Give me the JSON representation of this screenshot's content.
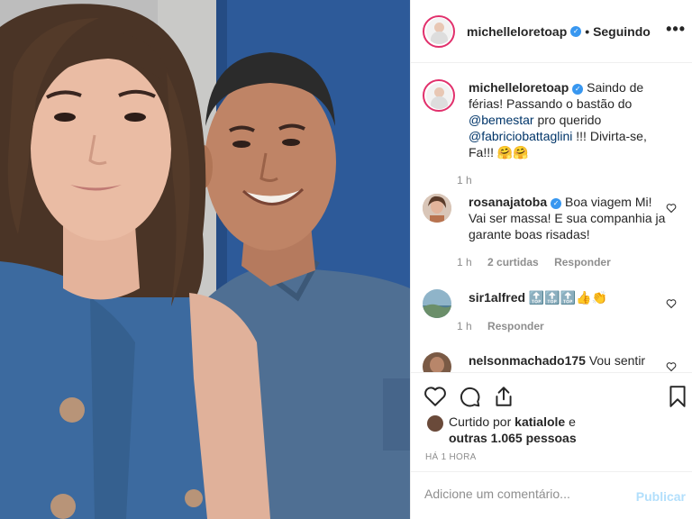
{
  "post": {
    "author": "michelleloretoap",
    "follow_status": "Seguindo",
    "more_label": "•••"
  },
  "caption": {
    "user": "michelleloretoap",
    "text_1": " Saindo de férias! Passando o bastão do ",
    "mention_1": "@bemestar",
    "text_2": " pro querido ",
    "mention_2": "@fabriciobattaglini",
    "text_3": " !!! Divirta-se, Fa!!! 🤗🤗",
    "time": "1 h"
  },
  "comments": [
    {
      "user": "rosanajatoba",
      "text": " Boa viagem Mi! Vai ser massa! E sua companhia ja garante boas risadas!",
      "time": "1 h",
      "likes": "2 curtidas",
      "reply": "Responder"
    },
    {
      "user": "sir1alfred",
      "text": " 🔝🔝🔝👍👏",
      "time": "1 h",
      "reply": "Responder"
    },
    {
      "user": "nelsonmachado175",
      "text": " Vou sentir"
    }
  ],
  "likes": {
    "prefix": "Curtido por ",
    "user": "katialole",
    "mid": " e",
    "others": "outras 1.065 pessoas"
  },
  "timestamp": "HÁ 1 HORA",
  "add_comment": {
    "placeholder": "Adicione um comentário...",
    "publish": "Publicar"
  },
  "colors": {
    "verified": "#3897f0",
    "mention": "#003569",
    "muted": "#8e8e8e",
    "publish_disabled": "#b2dffc",
    "avatar_ring": "#e1306c"
  }
}
